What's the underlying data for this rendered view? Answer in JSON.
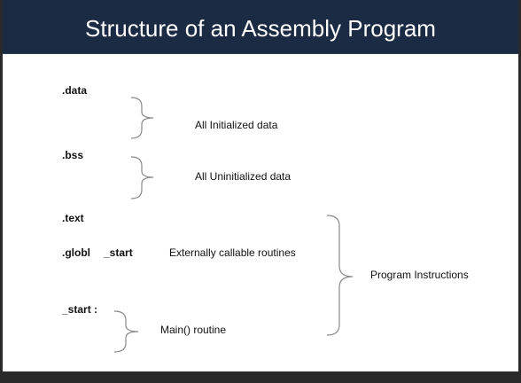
{
  "slide": {
    "title": "Structure of an Assembly Program",
    "directives": {
      "data": ".data",
      "bss": ".bss",
      "text": ".text",
      "globl": ".globl",
      "globl_arg": "_start",
      "start_label": "_start :"
    },
    "descriptions": {
      "initialized": "All Initialized data",
      "uninitialized": "All Uninitialized data",
      "callable": "Externally callable routines",
      "main_routine": "Main() routine",
      "program_instructions": "Program Instructions"
    }
  },
  "colors": {
    "title_bar": "#1c2b44",
    "title_text": "#ffffff",
    "background": "#ffffff",
    "brace": "#8a8a8a"
  }
}
